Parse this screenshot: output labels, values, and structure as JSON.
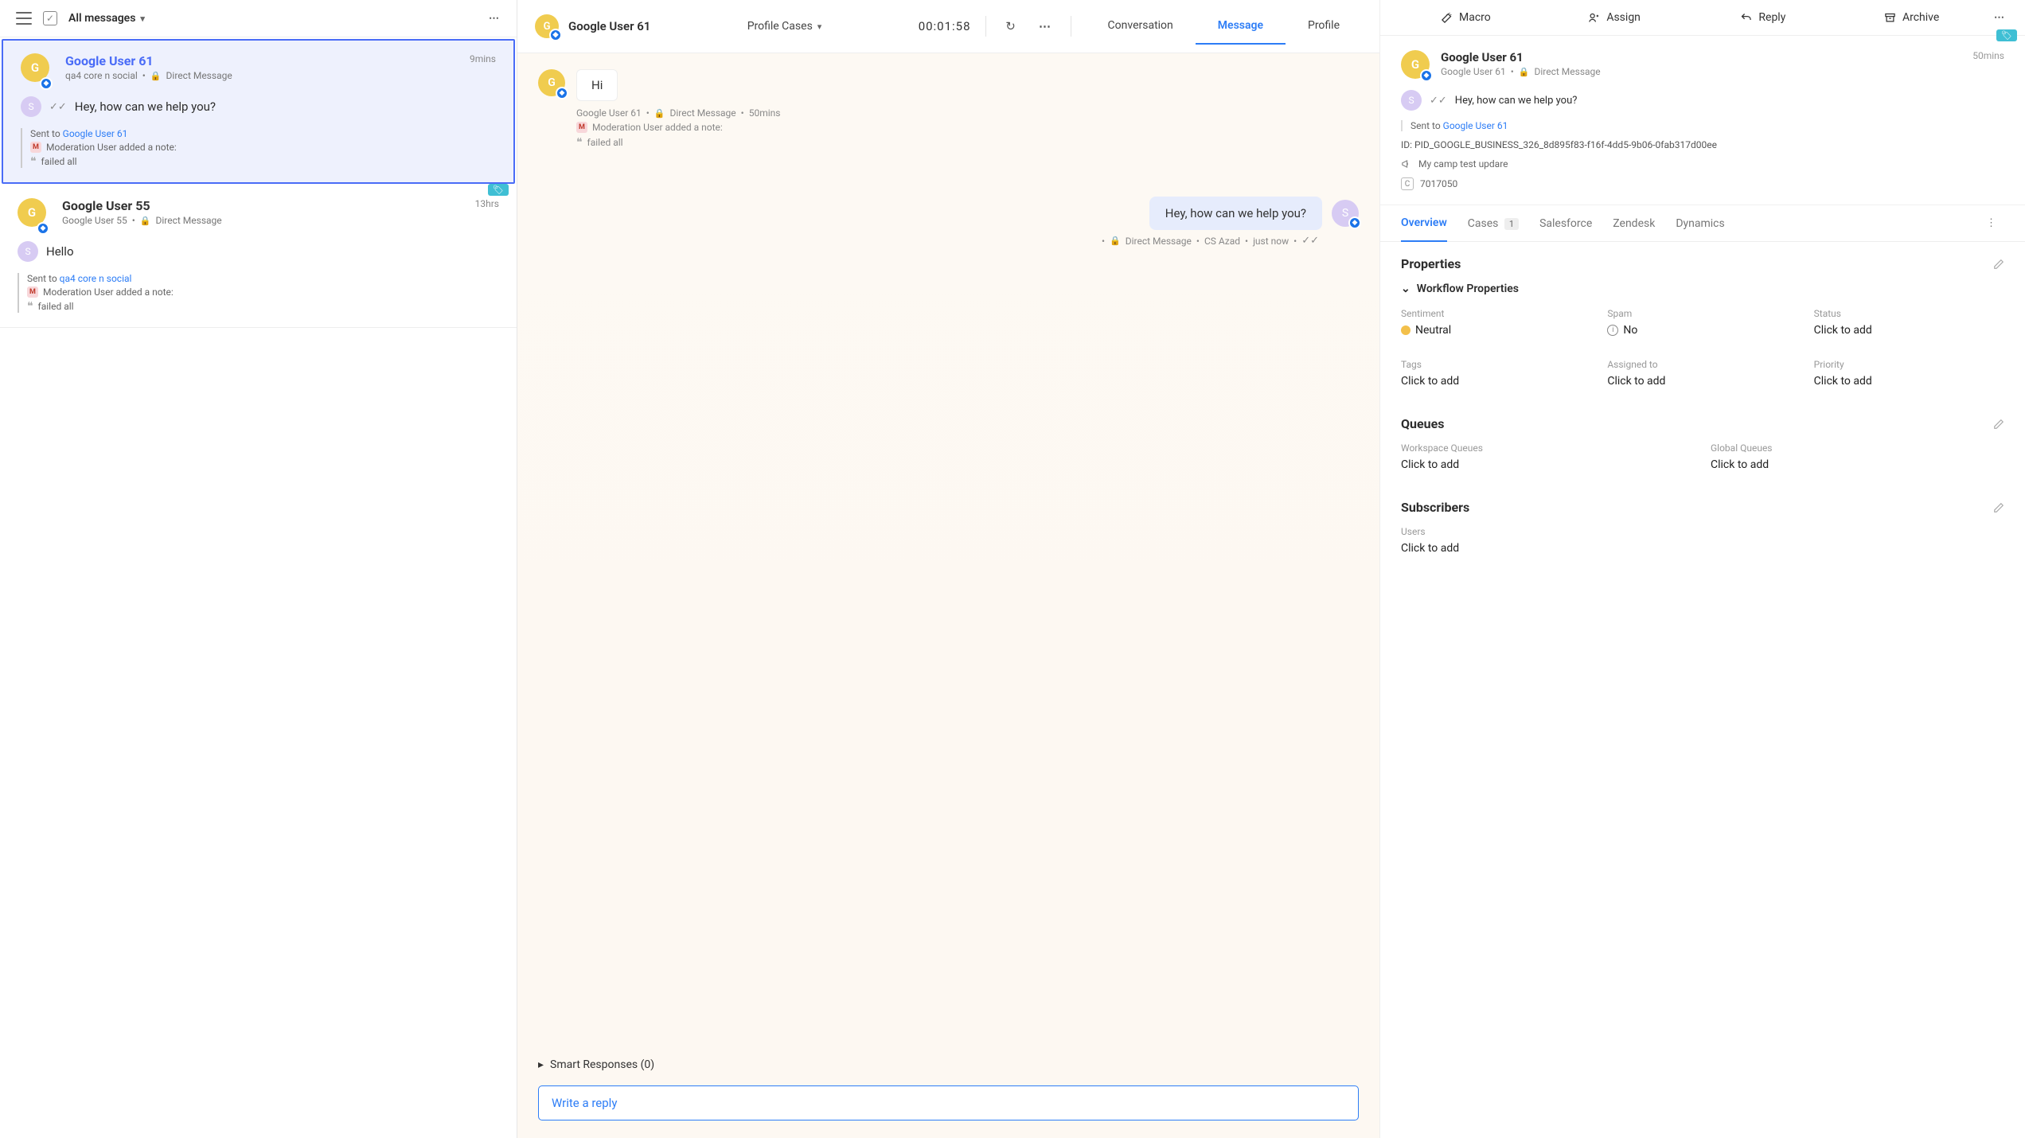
{
  "sidebar": {
    "filterLabel": "All messages",
    "items": [
      {
        "name": "Google User 61",
        "meta1": "qa4 core n social",
        "channel": "Direct Message",
        "time": "9mins",
        "preview": "Hey, how can we help you?",
        "sentToLabel": "Sent to",
        "sentToLink": "Google User 61",
        "noteLine": "Moderation User added a note:",
        "noteText": "failed all",
        "avatar1": "G",
        "avatar2": "S",
        "selected": true
      },
      {
        "name": "Google User 55",
        "meta1": "Google User 55",
        "channel": "Direct Message",
        "time": "13hrs",
        "preview": "Hello",
        "sentToLabel": "Sent to",
        "sentToLink": "qa4 core n social",
        "noteLine": "Moderation User added a note:",
        "noteText": "failed all",
        "avatar1": "G",
        "avatar2": "S",
        "selected": false
      }
    ]
  },
  "center": {
    "userName": "Google User 61",
    "userAvatar": "G",
    "profileCases": "Profile Cases",
    "timer": "00:01:58",
    "tabs": {
      "conversation": "Conversation",
      "message": "Message",
      "profile": "Profile"
    },
    "inMsg": {
      "avatar": "G",
      "text": "Hi",
      "metaUser": "Google User 61",
      "metaChannel": "Direct Message",
      "metaTime": "50mins",
      "noteLine": "Moderation User added a note:",
      "noteText": "failed all"
    },
    "outMsg": {
      "text": "Hey, how can we help you?",
      "avatar": "S",
      "metaChannel": "Direct Message",
      "metaAgent": "CS Azad",
      "metaTime": "just now"
    },
    "smartResponses": "Smart Responses (0)",
    "replyPlaceholder": "Write a reply"
  },
  "right": {
    "actions": {
      "macro": "Macro",
      "assign": "Assign",
      "reply": "Reply",
      "archive": "Archive"
    },
    "detail": {
      "avatar": "G",
      "name": "Google User 61",
      "subUser": "Google User 61",
      "subChannel": "Direct Message",
      "time": "50mins",
      "previewAvatar": "S",
      "preview": "Hey, how can we help you?",
      "sentToLabel": "Sent to",
      "sentToLink": "Google User 61",
      "idLabel": "ID:",
      "idValue": "PID_GOOGLE_BUSINESS_326_8d895f83-f16f-4dd5-9b06-0fab317d00ee",
      "campLabel": "My camp test updare",
      "caseId": "7017050"
    },
    "subTabs": {
      "overview": "Overview",
      "cases": "Cases",
      "casesCount": "1",
      "salesforce": "Salesforce",
      "zendesk": "Zendesk",
      "dynamics": "Dynamics"
    },
    "properties": {
      "title": "Properties",
      "workflowTitle": "Workflow Properties",
      "items": {
        "sentimentLabel": "Sentiment",
        "sentimentValue": "Neutral",
        "spamLabel": "Spam",
        "spamValue": "No",
        "statusLabel": "Status",
        "statusValue": "Click to add",
        "tagsLabel": "Tags",
        "tagsValue": "Click to add",
        "assignedLabel": "Assigned to",
        "assignedValue": "Click to add",
        "priorityLabel": "Priority",
        "priorityValue": "Click to add"
      }
    },
    "queues": {
      "title": "Queues",
      "wsLabel": "Workspace Queues",
      "wsValue": "Click to add",
      "globalLabel": "Global Queues",
      "globalValue": "Click to add"
    },
    "subscribers": {
      "title": "Subscribers",
      "usersLabel": "Users",
      "usersValue": "Click to add"
    }
  }
}
